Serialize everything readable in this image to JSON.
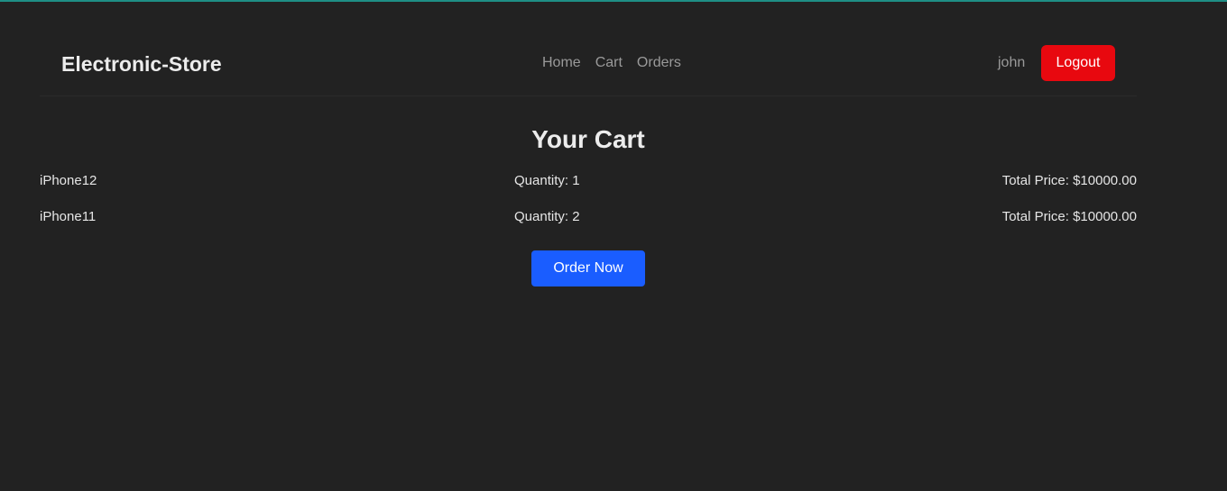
{
  "navbar": {
    "brand": "Electronic-Store",
    "links": [
      {
        "label": "Home"
      },
      {
        "label": "Cart"
      },
      {
        "label": "Orders"
      }
    ],
    "username": "john",
    "logout_label": "Logout"
  },
  "cart": {
    "title": "Your Cart",
    "items": [
      {
        "name": "iPhone12",
        "quantity": "Quantity: 1",
        "total": "Total Price: $10000.00"
      },
      {
        "name": "iPhone11",
        "quantity": "Quantity: 2",
        "total": "Total Price: $10000.00"
      }
    ],
    "order_label": "Order Now"
  },
  "colors": {
    "background": "#222222",
    "accent_top": "#1f8f86",
    "logout": "#e8080f",
    "order": "#1a5dff",
    "muted_text": "#9a9a9a"
  }
}
